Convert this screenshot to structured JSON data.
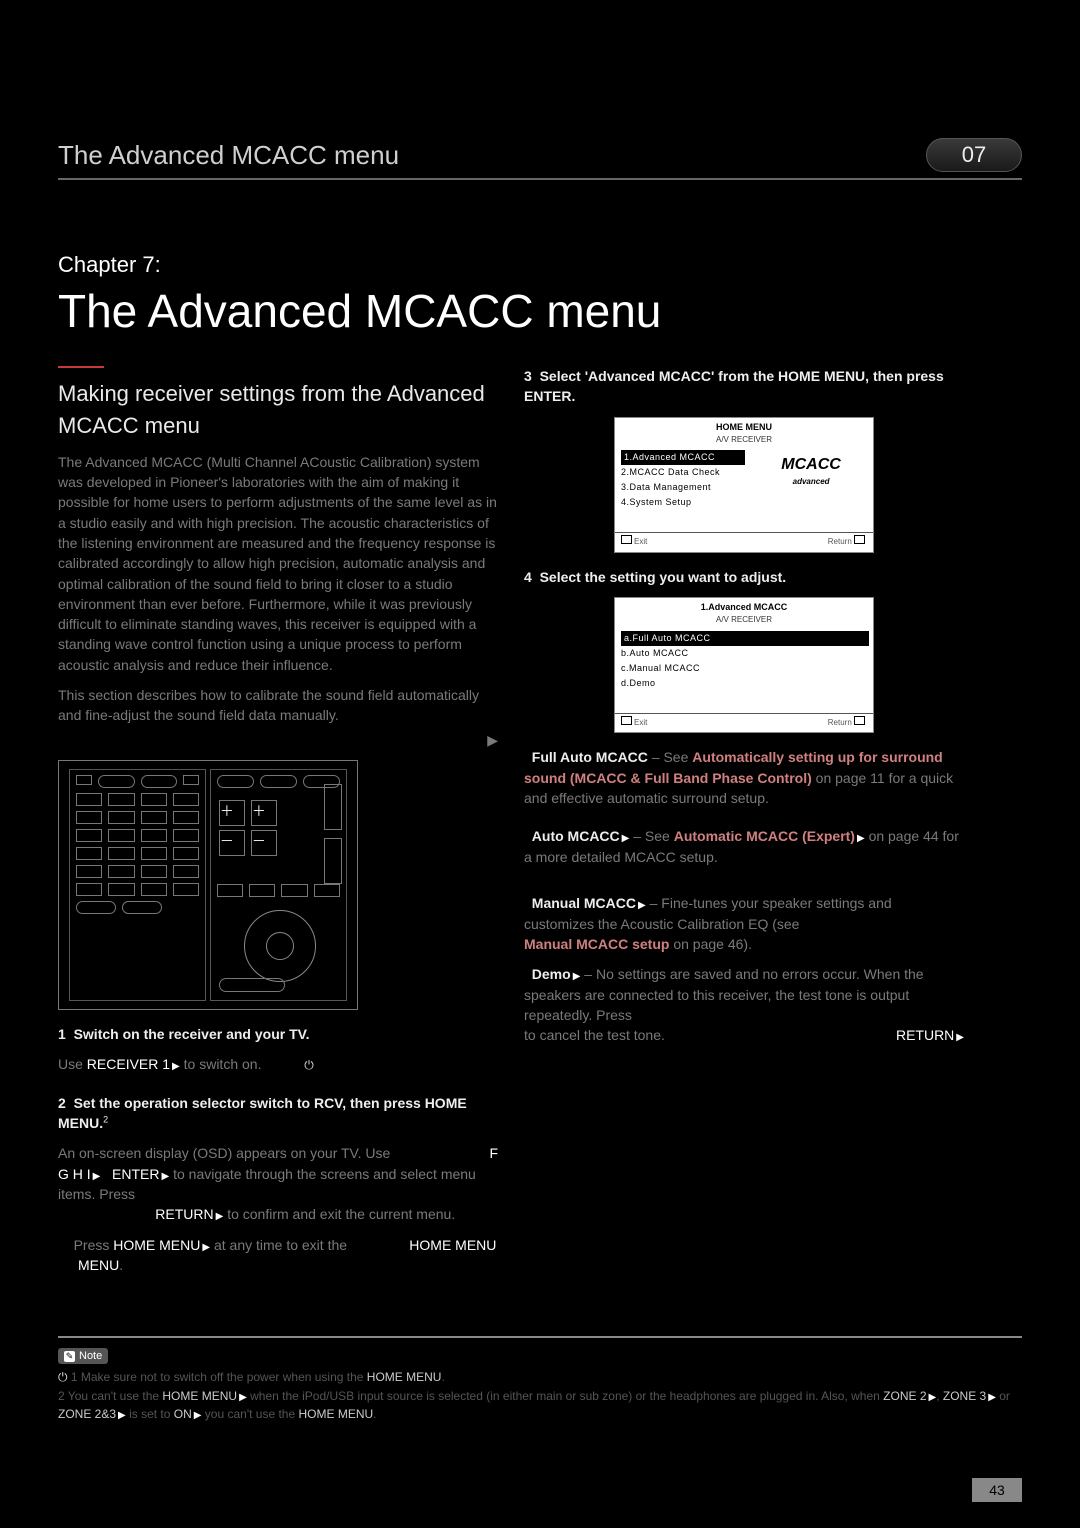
{
  "header": {
    "title": "The Advanced MCACC menu",
    "chapnum": "07"
  },
  "chapter": {
    "label": "Chapter 7:",
    "title": "The Advanced MCACC menu"
  },
  "left": {
    "subhead": "Making receiver settings from the Advanced MCACC menu",
    "intro_faint": "The Advanced MCACC (Multi Channel ACoustic Calibration) system was developed in Pioneer's laboratories with the aim of making it possible for home users to perform adjustments of the same level as in a studio easily and with high precision. The acoustic characteristics of the listening environment are measured and the frequency response is calibrated accordingly to allow high precision, automatic analysis and optimal calibration of the sound field to bring it closer to a studio environment than ever before. Furthermore, while it was previously difficult to eliminate standing waves, this receiver is equipped with a standing wave control function using a unique process to perform acoustic analysis and reduce their influence.",
    "intro2_faint": "This section describes how to calibrate the sound field automatically and fine-adjust the sound field data manually.",
    "step1": "Switch on the receiver and your TV.",
    "step1b_a": "Use ",
    "step1b_b": "RECEIVER 1",
    "step1b_c": " to switch on.",
    "step2": "Set the operation selector switch to RCV, then press HOME MENU.",
    "nav_faint_pre": "An on-screen display (OSD) appears on your TV. Use ",
    "nav_arrows": "G  H  I",
    "nav_enter": "ENTER",
    "nav_mid": " to navigate through the screens and select menu items. Press ",
    "nav_return": "RETURN",
    "nav_end": " to confirm and exit the current menu.",
    "nav2_a": "Press ",
    "nav2_b": "HOME MENU",
    "nav2_c": " at any time to exit the ",
    "nav2_d": "HOME MENU",
    "nav2_e": "."
  },
  "right": {
    "step3a": "Select 'Advanced MCACC' from the HOME MENU, then press ENTER.",
    "step4": "Select the setting you want to adjust.",
    "full_a": "Full Auto MCACC",
    "full_faint": " – See ",
    "full_b": "Automatically setting up for surround sound (MCACC & Full Band Phase Control)",
    "full_faint2": " on page 11 for a quick and effective automatic surround setup.",
    "auto_a": "Auto MCACC",
    "auto_faint": " – See ",
    "auto_b": "Automatic MCACC (Expert)",
    "auto_faint2": " on page 44 for a more detailed MCACC setup.",
    "man_a": "Manual MCACC",
    "man_faint": " – Fine-tunes your speaker settings and customizes the Acoustic Calibration EQ (see ",
    "man_b": "Manual MCACC setup",
    "man_faint2": " on page 46).",
    "demo_a": "Demo",
    "demo_faint": " – No settings are saved and no errors occur. When the speakers are connected to this receiver, the test tone is output repeatedly. Press ",
    "demo_b": "RETURN",
    "demo_faint2": " to cancel the test tone."
  },
  "osd1": {
    "title": "HOME MENU",
    "sub": "A/V RECEIVER",
    "i1": "1.Advanced MCACC",
    "i2": "2.MCACC Data Check",
    "i3": "3.Data Management",
    "i4": "4.System Setup",
    "logo": "MCACC",
    "adv": "advanced",
    "exit": "Exit",
    "ret": "Return"
  },
  "osd2": {
    "title": "1.Advanced MCACC",
    "sub": "A/V RECEIVER",
    "i1": "a.Full Auto MCACC",
    "i2": "b.Auto MCACC",
    "i3": "c.Manual MCACC",
    "i4": "d.Demo",
    "exit": "Exit",
    "ret": "Return"
  },
  "note": {
    "chip": "Note",
    "l1a": "1 Make sure not to switch off the power when using the ",
    "l1b": "HOME MENU",
    "l1c": ".",
    "l2a": "2 You can't use the ",
    "l2b": "HOME MENU",
    "l2c": " when the iPod/USB input source is selected (in either main or sub zone) or the headphones are plugged in. Also, when ",
    "l2d": "ZONE 2",
    "l2e": ", ",
    "l2f": "ZONE 3",
    "l2g": " or ",
    "l2h": "ZONE 2&3",
    "l2i": " is set to ",
    "l2j": "ON",
    "l2k": " you can't use the ",
    "l2l": "HOME MENU",
    "l2m": "."
  },
  "pagenum": "43",
  "icons": {
    "power": "⏻",
    "tri": "▶",
    "f": "F",
    "sup2": "2"
  }
}
